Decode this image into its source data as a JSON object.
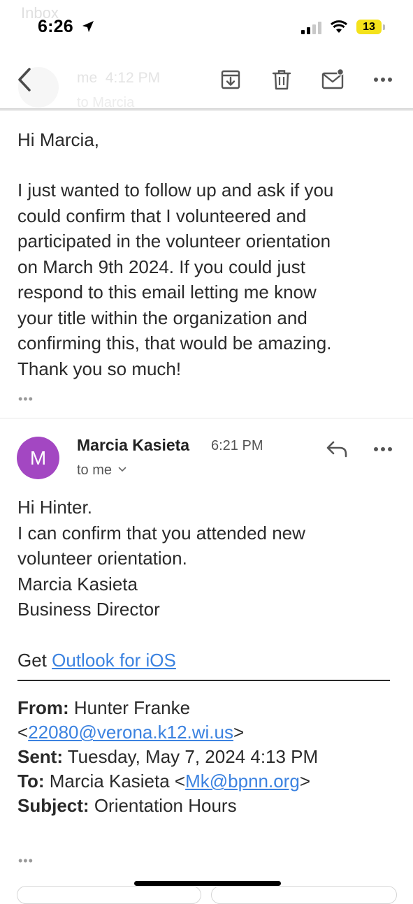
{
  "status_bar": {
    "time": "6:26",
    "battery": "13"
  },
  "header": {
    "back_overlay_label": "Inbox",
    "ghost_sender": "me",
    "ghost_time": "4:12 PM",
    "ghost_to": "to Marcia"
  },
  "toolbar": {
    "icons": [
      "archive-icon",
      "trash-icon",
      "mark-unread-icon",
      "more-icon"
    ]
  },
  "first_message": {
    "greeting": "Hi Marcia,",
    "lines": [
      "I just wanted to follow up and ask if you",
      "could confirm that I volunteered and",
      "participated in the volunteer orientation",
      "on March 9th 2024. If you could just",
      "respond to this email letting me know",
      "your title within the organization and",
      "confirming this, that would be amazing.",
      "Thank you so much!"
    ],
    "more_label": "•••"
  },
  "reply": {
    "avatar_letter": "M",
    "avatar_color": "#a347c2",
    "sender": "Marcia Kasieta",
    "time": "6:21 PM",
    "to": "to me",
    "lines": [
      "Hi Hinter.",
      "I can confirm that you attended new",
      "volunteer orientation.",
      "Marcia Kasieta",
      "Business Director"
    ],
    "signature_prefix": "Get ",
    "signature_link": "Outlook for iOS",
    "forwarded": {
      "from_label": "From:",
      "from_name": "Hunter Franke",
      "from_email_open": "<",
      "from_email": "22080@verona.k12.wi.us",
      "from_email_close": ">",
      "sent_label": "Sent:",
      "sent_value": "Tuesday, May 7, 2024 4:13 PM",
      "to_label": "To:",
      "to_name": "Marcia Kasieta <",
      "to_email": "Mk@bpnn.org",
      "to_close": ">",
      "subject_label": "Subject:",
      "subject_value": "Orientation Hours"
    },
    "more_label": "•••"
  },
  "colors": {
    "link": "#3b82e0",
    "battery": "#f4e21b"
  }
}
